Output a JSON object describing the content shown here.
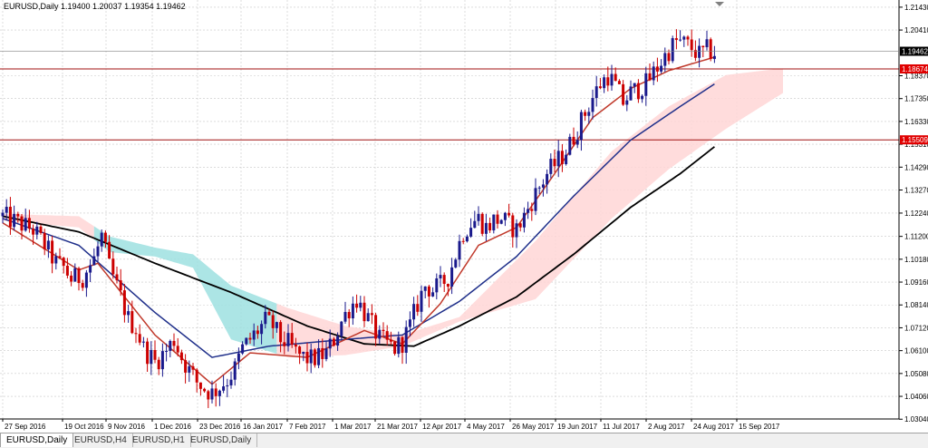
{
  "header": {
    "symbol_label": "EURUSD,Daily  1.19400 1.20037 1.19354 1.19462"
  },
  "tabs": [
    {
      "label": "EURUSD,Daily",
      "active": true
    },
    {
      "label": "EURUSD,H4",
      "active": false
    },
    {
      "label": "EURUSD,H1",
      "active": false
    },
    {
      "label": "EURUSD,Daily",
      "active": false
    }
  ],
  "colors": {
    "bull_candle": "#1a1a8c",
    "bear_candle": "#cc0000",
    "ma_fast": "#c0392b",
    "ma_mid": "#1f2f8a",
    "ma_slow": "#000000",
    "cloud_bull": "#9ee0e0",
    "cloud_bear": "#ffd6d6",
    "hline": "#a01010",
    "grid": "#c8c8c8",
    "price_tag_bg": "#000000",
    "level_tag_bg": "#e00000"
  },
  "chart_data": {
    "type": "candlestick",
    "symbol": "EURUSD",
    "timeframe": "Daily",
    "ohlc_last": {
      "open": 1.194,
      "high": 1.20037,
      "low": 1.19354,
      "close": 1.19462
    },
    "ylim": [
      1.0305,
      1.2175
    ],
    "yticks": [
      "1.21430",
      "1.20410",
      "1.18370",
      "1.17350",
      "1.16330",
      "1.15310",
      "1.14290",
      "1.13270",
      "1.12240",
      "1.11200",
      "1.10180",
      "1.09160",
      "1.08140",
      "1.07120",
      "1.06100",
      "1.05080",
      "1.04060",
      "1.03040"
    ],
    "xticks": [
      "27 Sep 2016",
      "19 Oct 2016",
      "9 Nov 2016",
      "1 Dec 2016",
      "23 Dec 2016",
      "16 Jan 2017",
      "7 Feb 2017",
      "1 Mar 2017",
      "21 Mar 2017",
      "12 Apr 2017",
      "4 May 2017",
      "26 May 2017",
      "19 Jun 2017",
      "11 Jul 2017",
      "2 Aug 2017",
      "24 Aug 2017",
      "15 Sep 2017"
    ],
    "current_price": "1.19462",
    "horizontal_levels": [
      {
        "value": 1.18674,
        "label": "1.18674"
      },
      {
        "value": 1.15509,
        "label": "1.15509"
      }
    ],
    "close_path": [
      [
        0,
        1.121
      ],
      [
        4,
        1.118
      ],
      [
        8,
        1.115
      ],
      [
        11,
        1.108
      ],
      [
        14,
        1.1
      ],
      [
        16,
        1.098
      ],
      [
        18,
        1.093
      ],
      [
        21,
        1.094
      ],
      [
        24,
        1.102
      ],
      [
        26,
        1.112
      ],
      [
        27,
        1.105
      ],
      [
        28,
        1.098
      ],
      [
        31,
        1.085
      ],
      [
        33,
        1.075
      ],
      [
        35,
        1.071
      ],
      [
        37,
        1.062
      ],
      [
        40,
        1.056
      ],
      [
        43,
        1.061
      ],
      [
        45,
        1.066
      ],
      [
        47,
        1.058
      ],
      [
        49,
        1.052
      ],
      [
        51,
        1.047
      ],
      [
        53,
        1.044
      ],
      [
        55,
        1.042
      ],
      [
        57,
        1.045
      ],
      [
        59,
        1.048
      ],
      [
        61,
        1.053
      ],
      [
        63,
        1.062
      ],
      [
        65,
        1.066
      ],
      [
        67,
        1.07
      ],
      [
        69,
        1.074
      ],
      [
        71,
        1.072
      ],
      [
        73,
        1.066
      ],
      [
        75,
        1.064
      ],
      [
        77,
        1.06
      ],
      [
        79,
        1.058
      ],
      [
        81,
        1.057
      ],
      [
        83,
        1.058
      ],
      [
        85,
        1.06
      ],
      [
        87,
        1.066
      ],
      [
        89,
        1.074
      ],
      [
        91,
        1.08
      ],
      [
        93,
        1.084
      ],
      [
        95,
        1.078
      ],
      [
        97,
        1.072
      ],
      [
        99,
        1.066
      ],
      [
        101,
        1.064
      ],
      [
        103,
        1.062
      ],
      [
        105,
        1.065
      ],
      [
        107,
        1.072
      ],
      [
        109,
        1.082
      ],
      [
        111,
        1.09
      ],
      [
        113,
        1.088
      ],
      [
        115,
        1.09
      ],
      [
        117,
        1.094
      ],
      [
        119,
        1.104
      ],
      [
        121,
        1.114
      ],
      [
        123,
        1.118
      ],
      [
        125,
        1.12
      ],
      [
        127,
        1.116
      ],
      [
        129,
        1.119
      ],
      [
        131,
        1.12
      ],
      [
        133,
        1.117
      ],
      [
        135,
        1.115
      ],
      [
        137,
        1.121
      ],
      [
        139,
        1.128
      ],
      [
        141,
        1.134
      ],
      [
        143,
        1.14
      ],
      [
        145,
        1.144
      ],
      [
        147,
        1.148
      ],
      [
        149,
        1.153
      ],
      [
        151,
        1.16
      ],
      [
        153,
        1.167
      ],
      [
        155,
        1.174
      ],
      [
        157,
        1.18
      ],
      [
        159,
        1.184
      ],
      [
        161,
        1.179
      ],
      [
        163,
        1.172
      ],
      [
        165,
        1.176
      ],
      [
        167,
        1.178
      ],
      [
        169,
        1.18
      ],
      [
        171,
        1.185
      ],
      [
        173,
        1.19
      ],
      [
        175,
        1.195
      ],
      [
        177,
        1.199
      ],
      [
        179,
        1.198
      ],
      [
        181,
        1.196
      ],
      [
        183,
        1.193
      ],
      [
        185,
        1.195
      ],
      [
        187,
        1.194
      ]
    ],
    "ma_fast": [
      [
        0,
        1.118
      ],
      [
        20,
        1.097
      ],
      [
        25,
        1.1
      ],
      [
        40,
        1.068
      ],
      [
        55,
        1.046
      ],
      [
        65,
        1.06
      ],
      [
        80,
        1.058
      ],
      [
        95,
        1.07
      ],
      [
        105,
        1.064
      ],
      [
        115,
        1.082
      ],
      [
        125,
        1.108
      ],
      [
        135,
        1.116
      ],
      [
        145,
        1.14
      ],
      [
        155,
        1.165
      ],
      [
        165,
        1.178
      ],
      [
        175,
        1.186
      ],
      [
        187,
        1.192
      ]
    ],
    "ma_mid": [
      [
        0,
        1.12
      ],
      [
        20,
        1.108
      ],
      [
        40,
        1.078
      ],
      [
        55,
        1.058
      ],
      [
        70,
        1.063
      ],
      [
        90,
        1.066
      ],
      [
        105,
        1.068
      ],
      [
        120,
        1.083
      ],
      [
        135,
        1.103
      ],
      [
        150,
        1.13
      ],
      [
        165,
        1.155
      ],
      [
        178,
        1.17
      ],
      [
        187,
        1.18
      ]
    ],
    "ma_slow": [
      [
        0,
        1.121
      ],
      [
        20,
        1.114
      ],
      [
        40,
        1.1
      ],
      [
        60,
        1.087
      ],
      [
        80,
        1.072
      ],
      [
        95,
        1.064
      ],
      [
        108,
        1.063
      ],
      [
        120,
        1.072
      ],
      [
        135,
        1.085
      ],
      [
        150,
        1.104
      ],
      [
        165,
        1.125
      ],
      [
        178,
        1.14
      ],
      [
        187,
        1.152
      ]
    ],
    "cloud_upper": [
      [
        0,
        1.122
      ],
      [
        20,
        1.121
      ],
      [
        28,
        1.112
      ],
      [
        40,
        1.107
      ],
      [
        50,
        1.104
      ],
      [
        60,
        1.09
      ],
      [
        75,
        1.08
      ],
      [
        90,
        1.072
      ],
      [
        105,
        1.068
      ],
      [
        120,
        1.076
      ],
      [
        140,
        1.11
      ],
      [
        160,
        1.15
      ],
      [
        175,
        1.17
      ],
      [
        190,
        1.184
      ],
      [
        205,
        1.187
      ]
    ],
    "cloud_lower": [
      [
        0,
        1.119
      ],
      [
        20,
        1.116
      ],
      [
        28,
        1.105
      ],
      [
        40,
        1.103
      ],
      [
        50,
        1.098
      ],
      [
        60,
        1.066
      ],
      [
        75,
        1.058
      ],
      [
        90,
        1.059
      ],
      [
        105,
        1.063
      ],
      [
        120,
        1.074
      ],
      [
        140,
        1.084
      ],
      [
        160,
        1.12
      ],
      [
        175,
        1.142
      ],
      [
        190,
        1.16
      ],
      [
        205,
        1.176
      ]
    ],
    "cloud_bull_ranges": [
      [
        24,
        72
      ]
    ]
  }
}
